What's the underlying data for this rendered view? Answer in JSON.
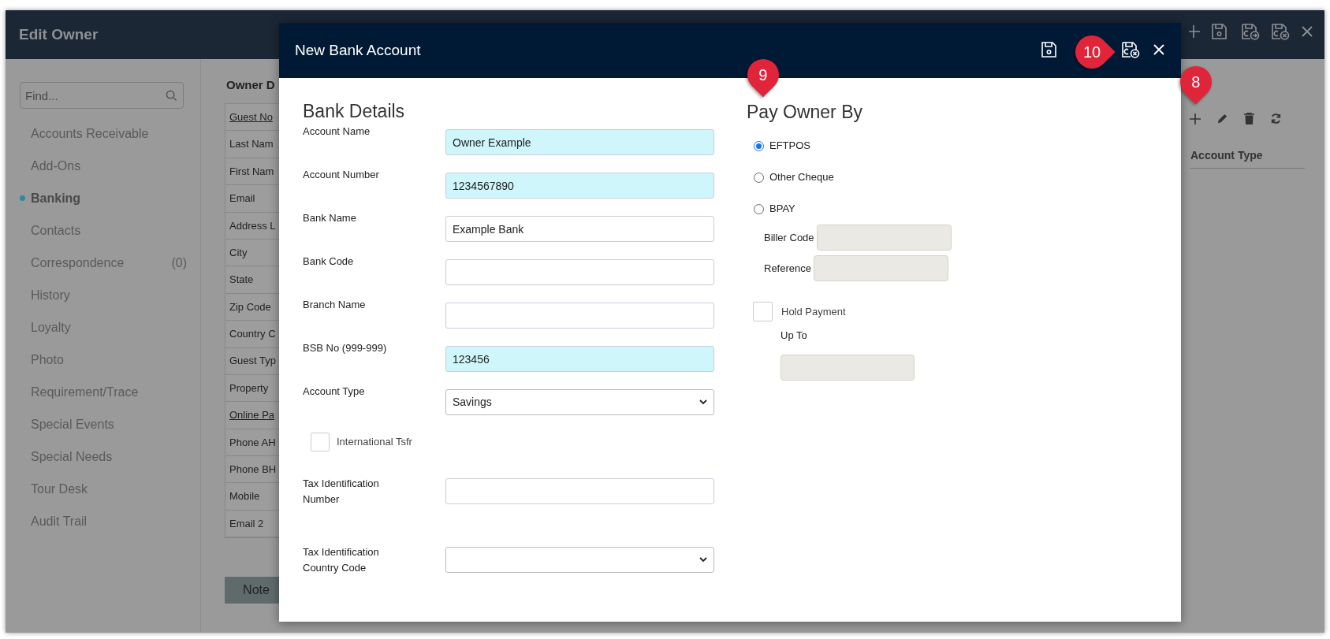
{
  "app": {
    "title": "Edit Owner"
  },
  "sidebar": {
    "search": {
      "placeholder": "Find..."
    },
    "items": [
      {
        "label": "Accounts Receivable",
        "selected": false
      },
      {
        "label": "Add-Ons",
        "selected": false
      },
      {
        "label": "Banking",
        "selected": true
      },
      {
        "label": "Contacts",
        "selected": false
      },
      {
        "label": "Correspondence",
        "selected": false,
        "count": "(0)"
      },
      {
        "label": "History",
        "selected": false
      },
      {
        "label": "Loyalty",
        "selected": false
      },
      {
        "label": "Photo",
        "selected": false
      },
      {
        "label": "Requirement/Trace",
        "selected": false
      },
      {
        "label": "Special Events",
        "selected": false
      },
      {
        "label": "Special Needs",
        "selected": false
      },
      {
        "label": "Tour Desk",
        "selected": false
      },
      {
        "label": "Audit Trail",
        "selected": false
      }
    ]
  },
  "owner_details": {
    "title": "Owner D",
    "rows": [
      {
        "label": "Guest No",
        "kind": "link"
      },
      {
        "label": "Last Nam",
        "kind": "plain"
      },
      {
        "label": "First Nam",
        "kind": "plain"
      },
      {
        "label": "Email",
        "kind": "plain"
      },
      {
        "label": "Address L",
        "kind": "plain"
      },
      {
        "label": "City",
        "kind": "plain"
      },
      {
        "label": "State",
        "kind": "plain"
      },
      {
        "label": "Zip Code",
        "kind": "plain"
      },
      {
        "label": "Country C",
        "kind": "plain"
      },
      {
        "label": "Guest Typ",
        "kind": "plain"
      },
      {
        "label": "Property",
        "kind": "plain"
      },
      {
        "label": "Online Pa",
        "kind": "link"
      },
      {
        "label": "Phone AH",
        "kind": "plain"
      },
      {
        "label": "Phone BH",
        "kind": "plain"
      },
      {
        "label": "Mobile",
        "kind": "plain"
      },
      {
        "label": "Email 2",
        "kind": "plain"
      }
    ],
    "note_button": "Note"
  },
  "banking_table": {
    "columns": [
      "Account Type"
    ]
  },
  "dialog": {
    "title": "New Bank Account",
    "bank_details": {
      "heading": "Bank Details",
      "fields": [
        {
          "kind": "text",
          "label": "Account Name",
          "value": "Owner Example",
          "required": true
        },
        {
          "kind": "text",
          "label": "Account Number",
          "value": "1234567890",
          "required": true
        },
        {
          "kind": "text",
          "label": "Bank Name",
          "value": "Example Bank",
          "required": false
        },
        {
          "kind": "text",
          "label": "Bank Code",
          "required": false
        },
        {
          "kind": "text",
          "label": "Branch Name",
          "required": false
        },
        {
          "kind": "text",
          "label": "BSB No (999-999)",
          "value": "123456",
          "required": true
        },
        {
          "kind": "select",
          "label": "Account Type",
          "value": "Savings"
        },
        {
          "kind": "checkbox",
          "label": "International Tsfr",
          "checked": false
        },
        {
          "kind": "text",
          "label": "Tax Identification Number",
          "required": false
        },
        {
          "kind": "select",
          "label": "Tax Identification Country Code"
        }
      ]
    },
    "pay_owner_by": {
      "heading": "Pay Owner By",
      "options": [
        {
          "label": "EFTPOS",
          "selected": true
        },
        {
          "label": "Other Cheque",
          "selected": false
        },
        {
          "label": "BPAY",
          "selected": false
        }
      ],
      "biller_code": {
        "label": "Biller Code",
        "disabled": true
      },
      "reference": {
        "label": "Reference",
        "disabled": true
      },
      "hold_payment": {
        "label": "Hold Payment",
        "checked": false
      },
      "up_to": {
        "label": "Up To",
        "disabled": true
      }
    }
  },
  "callouts": [
    {
      "label": "10"
    },
    {
      "label": "9"
    },
    {
      "label": "8"
    }
  ]
}
